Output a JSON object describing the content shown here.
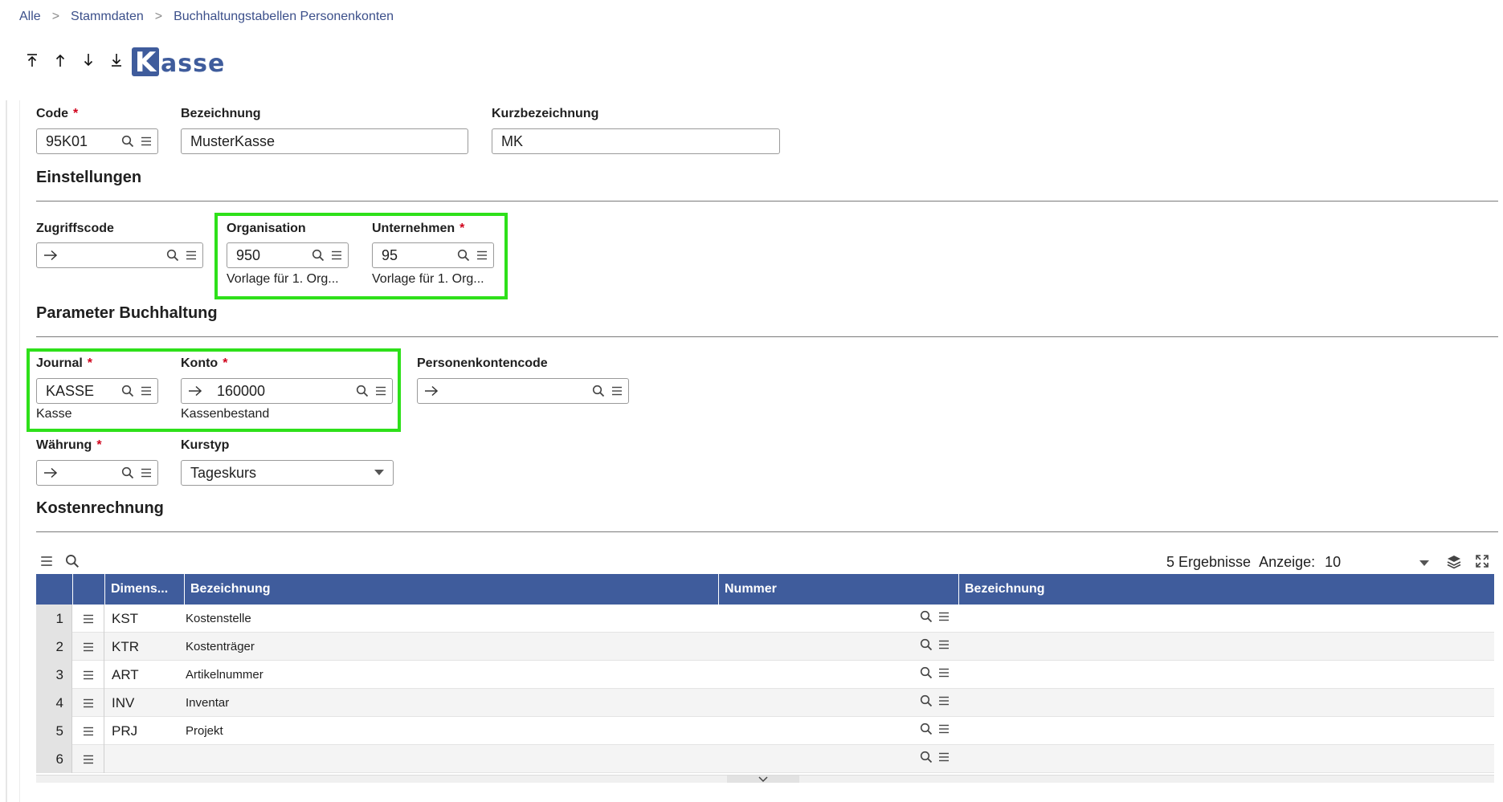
{
  "breadcrumb": [
    "Alle",
    "Stammdaten",
    "Buchhaltungstabellen Personenkonten"
  ],
  "logo_text": "Kasse",
  "header_fields": {
    "code_label": "Code",
    "code_value": "95K01",
    "bezeichnung_label": "Bezeichnung",
    "bezeichnung_value": "MusterKasse",
    "kurz_label": "Kurzbezeichnung",
    "kurz_value": "MK"
  },
  "einstellungen": {
    "title": "Einstellungen",
    "zugriff_label": "Zugriffscode",
    "zugriff_value": "",
    "org_label": "Organisation",
    "org_value": "950",
    "org_sub": "Vorlage für 1. Org...",
    "unternehmen_label": "Unternehmen",
    "unternehmen_value": "95",
    "unternehmen_sub": "Vorlage für 1. Org..."
  },
  "parameter": {
    "title": "Parameter Buchhaltung",
    "journal_label": "Journal",
    "journal_value": "KASSE",
    "journal_sub": "Kasse",
    "konto_label": "Konto",
    "konto_value": "160000",
    "konto_sub": "Kassenbestand",
    "personen_label": "Personenkontencode",
    "personen_value": "",
    "waehrung_label": "Währung",
    "waehrung_value": "",
    "kurstyp_label": "Kurstyp",
    "kurstyp_value": "Tageskurs"
  },
  "kosten": {
    "title": "Kostenrechnung",
    "results_text": "5 Ergebnisse",
    "anzeige_label": "Anzeige:",
    "anzeige_value": "10",
    "columns": [
      "Dimens...",
      "Bezeichnung",
      "Nummer",
      "Bezeichnung"
    ],
    "rows": [
      {
        "n": "1",
        "dim": "KST",
        "bez": "Kostenstelle"
      },
      {
        "n": "2",
        "dim": "KTR",
        "bez": "Kostenträger"
      },
      {
        "n": "3",
        "dim": "ART",
        "bez": "Artikelnummer"
      },
      {
        "n": "4",
        "dim": "INV",
        "bez": "Inventar"
      },
      {
        "n": "5",
        "dim": "PRJ",
        "bez": "Projekt"
      },
      {
        "n": "6",
        "dim": "",
        "bez": ""
      }
    ]
  },
  "colors": {
    "accent": "#3f5c9c",
    "highlight": "#2ee01a",
    "required": "#d0021b",
    "link": "#3b4f8a"
  }
}
